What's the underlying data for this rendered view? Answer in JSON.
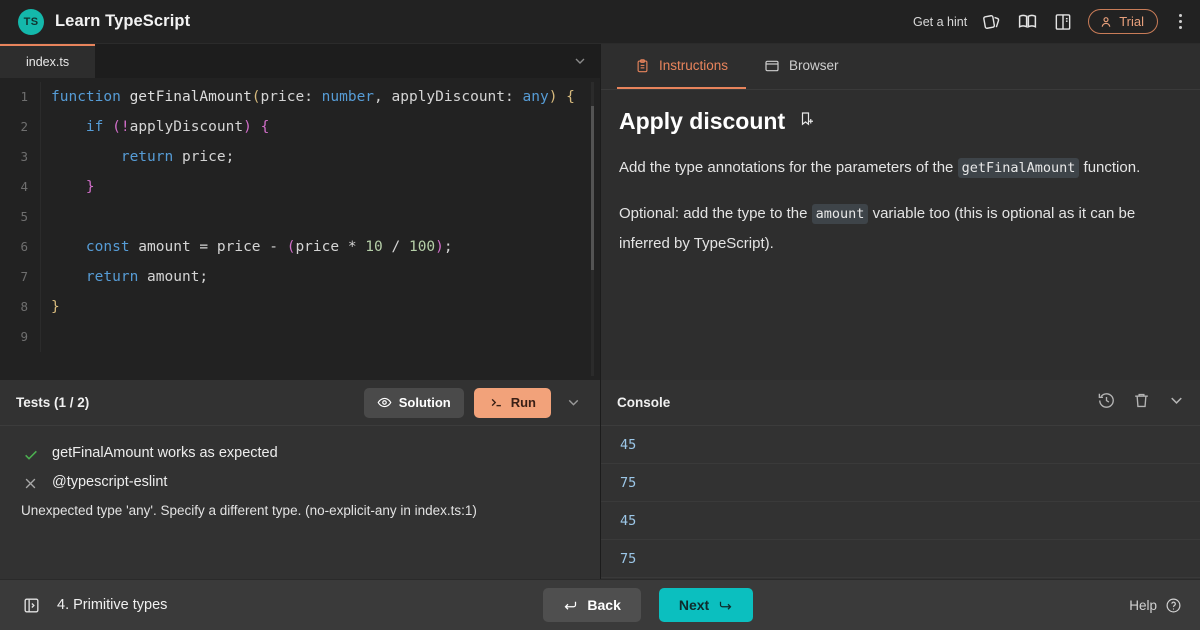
{
  "header": {
    "logo_text": "TS",
    "title": "Learn TypeScript",
    "hint_label": "Get a hint",
    "icons": [
      "cards-icon",
      "book-icon",
      "book-open-icon"
    ],
    "trial_label": "Trial",
    "accent_teal": "#14b8ab",
    "accent_orange": "#e8845c"
  },
  "editor": {
    "tab_label": "index.ts",
    "lines": [
      {
        "num": "1",
        "tokens": [
          {
            "t": "function",
            "c": "kw"
          },
          {
            "t": " ",
            "c": "op"
          },
          {
            "t": "getFinalAmount",
            "c": "fn"
          },
          {
            "t": "(",
            "c": "p-yellow"
          },
          {
            "t": "price",
            "c": "op"
          },
          {
            "t": ": ",
            "c": "op"
          },
          {
            "t": "number",
            "c": "type"
          },
          {
            "t": ", ",
            "c": "op"
          },
          {
            "t": "applyDiscount",
            "c": "op"
          },
          {
            "t": ": ",
            "c": "op"
          },
          {
            "t": "any",
            "c": "type"
          },
          {
            "t": ")",
            "c": "p-yellow"
          },
          {
            "t": " ",
            "c": "op"
          },
          {
            "t": "{",
            "c": "p-yellow"
          }
        ]
      },
      {
        "num": "2",
        "tokens": [
          {
            "t": "    ",
            "c": "op"
          },
          {
            "t": "if",
            "c": "kw"
          },
          {
            "t": " ",
            "c": "op"
          },
          {
            "t": "(",
            "c": "p-purple"
          },
          {
            "t": "!",
            "c": "p-purple"
          },
          {
            "t": "applyDiscount",
            "c": "op"
          },
          {
            "t": ")",
            "c": "p-purple"
          },
          {
            "t": " ",
            "c": "op"
          },
          {
            "t": "{",
            "c": "p-purple"
          }
        ]
      },
      {
        "num": "3",
        "tokens": [
          {
            "t": "        ",
            "c": "op"
          },
          {
            "t": "return",
            "c": "kw"
          },
          {
            "t": " price;",
            "c": "op"
          }
        ]
      },
      {
        "num": "4",
        "tokens": [
          {
            "t": "    ",
            "c": "op"
          },
          {
            "t": "}",
            "c": "p-purple"
          }
        ]
      },
      {
        "num": "5",
        "tokens": [
          {
            "t": "",
            "c": "op"
          }
        ]
      },
      {
        "num": "6",
        "tokens": [
          {
            "t": "    ",
            "c": "op"
          },
          {
            "t": "const",
            "c": "kw"
          },
          {
            "t": " amount = price - ",
            "c": "op"
          },
          {
            "t": "(",
            "c": "p-purple"
          },
          {
            "t": "price * ",
            "c": "op"
          },
          {
            "t": "10",
            "c": "num"
          },
          {
            "t": " / ",
            "c": "op"
          },
          {
            "t": "100",
            "c": "num"
          },
          {
            "t": ")",
            "c": "p-purple"
          },
          {
            "t": ";",
            "c": "op"
          }
        ]
      },
      {
        "num": "7",
        "tokens": [
          {
            "t": "    ",
            "c": "op"
          },
          {
            "t": "return",
            "c": "kw"
          },
          {
            "t": " amount;",
            "c": "op"
          }
        ]
      },
      {
        "num": "8",
        "tokens": [
          {
            "t": "}",
            "c": "p-yellow"
          }
        ]
      },
      {
        "num": "9",
        "tokens": [
          {
            "t": "",
            "c": "op"
          }
        ]
      }
    ]
  },
  "tests": {
    "title": "Tests (1 / 2)",
    "solution_label": "Solution",
    "run_label": "Run",
    "items": [
      {
        "status": "pass",
        "label": "getFinalAmount works as expected",
        "message": ""
      },
      {
        "status": "fail",
        "label": "@typescript-eslint",
        "message": "Unexpected type 'any'. Specify a different type. (no-explicit-any in index.ts:1)"
      }
    ]
  },
  "instructions": {
    "tabs": [
      {
        "label": "Instructions",
        "icon": "clipboard-icon",
        "active": true
      },
      {
        "label": "Browser",
        "icon": "browser-window-icon",
        "active": false
      }
    ],
    "title": "Apply discount",
    "paragraphs": [
      {
        "parts": [
          {
            "t": "Add the type annotations for the parameters of the ",
            "code": false
          },
          {
            "t": "getFinalAmount",
            "code": true
          },
          {
            "t": " function.",
            "code": false
          }
        ]
      },
      {
        "parts": [
          {
            "t": "Optional: add the type to the ",
            "code": false
          },
          {
            "t": "amount",
            "code": true
          },
          {
            "t": " variable too (this is optional as it can be inferred by TypeScript).",
            "code": false
          }
        ]
      }
    ]
  },
  "console": {
    "title": "Console",
    "rows": [
      "45",
      "75",
      "45",
      "75"
    ]
  },
  "bottombar": {
    "lesson": "4. Primitive types",
    "back_label": "Back",
    "next_label": "Next",
    "help_label": "Help"
  }
}
